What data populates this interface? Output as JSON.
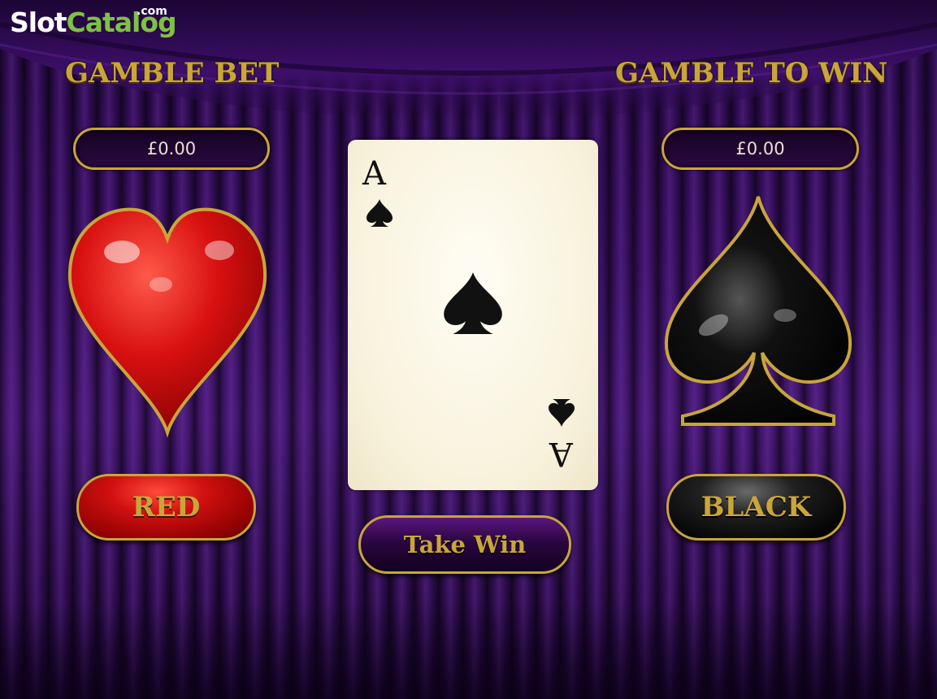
{
  "logo": {
    "slot": "Slot",
    "catalog": "Catalog",
    "com": ".com"
  },
  "gamble_bet": {
    "title": "GAMBLE BET",
    "amount": "£0.00"
  },
  "gamble_to_win": {
    "title": "GAMBLE TO WIN",
    "amount": "£0.00"
  },
  "card": {
    "rank": "A",
    "suit": "spade-icon"
  },
  "buttons": {
    "red": "RED",
    "black": "BLACK",
    "take_win": "Take Win"
  },
  "icons": {
    "left_suit": "heart-icon",
    "right_suit": "spade-icon"
  },
  "colors": {
    "gold": "#c9a53a",
    "curtain_purple": "#3b1066",
    "red": "#d01010",
    "black": "#000000",
    "logo_green": "#7dc242"
  }
}
